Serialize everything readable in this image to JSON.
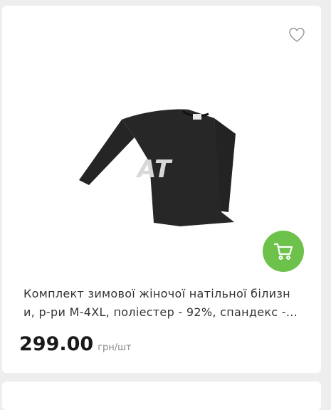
{
  "product": {
    "title_line1": "Комплект зимової жіночої натільної білизн",
    "title_line2": "и, р-ри M-4XL, поліестер - 92%, спандекс -...",
    "price": "299.00",
    "unit": "грн/шт",
    "watermark": "AT",
    "image_subject": "black long-sleeve women's thermal top",
    "icons": {
      "favorite": "heart-outline-icon",
      "cart": "cart-icon"
    }
  },
  "colors": {
    "accent": "#6cc24a",
    "text": "#333333",
    "price": "#1a1a1a",
    "muted": "#8a8a8a",
    "background": "#eeeeee",
    "garment": "#262626"
  }
}
